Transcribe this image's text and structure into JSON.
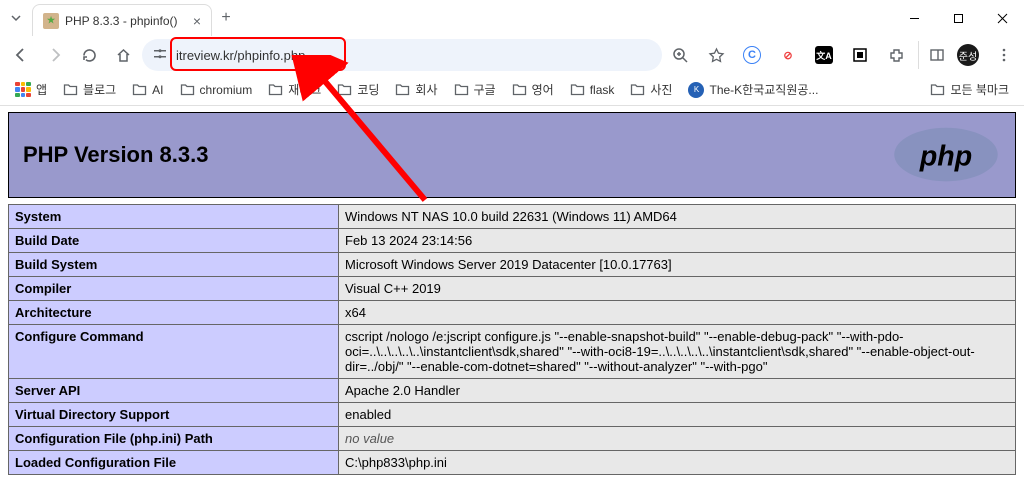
{
  "window": {
    "tab_title": "PHP 8.3.3 - phpinfo()",
    "url": "itreview.kr/phpinfo.php"
  },
  "bookmarks": {
    "apps": "앱",
    "items": [
      "블로그",
      "AI",
      "chromium",
      "재테크",
      "코딩",
      "회사",
      "구글",
      "영어",
      "flask",
      "사진"
    ],
    "thek": "The-K한국교직원공...",
    "all": "모든 북마크"
  },
  "php": {
    "header": "PHP Version 8.3.3",
    "rows": [
      {
        "k": "System",
        "v": "Windows NT NAS 10.0 build 22631 (Windows 11) AMD64"
      },
      {
        "k": "Build Date",
        "v": "Feb 13 2024 23:14:56"
      },
      {
        "k": "Build System",
        "v": "Microsoft Windows Server 2019 Datacenter [10.0.17763]"
      },
      {
        "k": "Compiler",
        "v": "Visual C++ 2019"
      },
      {
        "k": "Architecture",
        "v": "x64"
      },
      {
        "k": "Configure Command",
        "v": "cscript /nologo /e:jscript configure.js \"--enable-snapshot-build\" \"--enable-debug-pack\" \"--with-pdo-oci=..\\..\\..\\..\\..\\instantclient\\sdk,shared\" \"--with-oci8-19=..\\..\\..\\..\\..\\instantclient\\sdk,shared\" \"--enable-object-out-dir=../obj/\" \"--enable-com-dotnet=shared\" \"--without-analyzer\" \"--with-pgo\""
      },
      {
        "k": "Server API",
        "v": "Apache 2.0 Handler"
      },
      {
        "k": "Virtual Directory Support",
        "v": "enabled"
      },
      {
        "k": "Configuration File (php.ini) Path",
        "v": "no value",
        "novalue": true
      },
      {
        "k": "Loaded Configuration File",
        "v": "C:\\php833\\php.ini"
      }
    ]
  },
  "ext": {
    "c_color": "#3b82f6",
    "s_color": "#ef4444",
    "n_color": "#000",
    "box_color": "#000"
  }
}
